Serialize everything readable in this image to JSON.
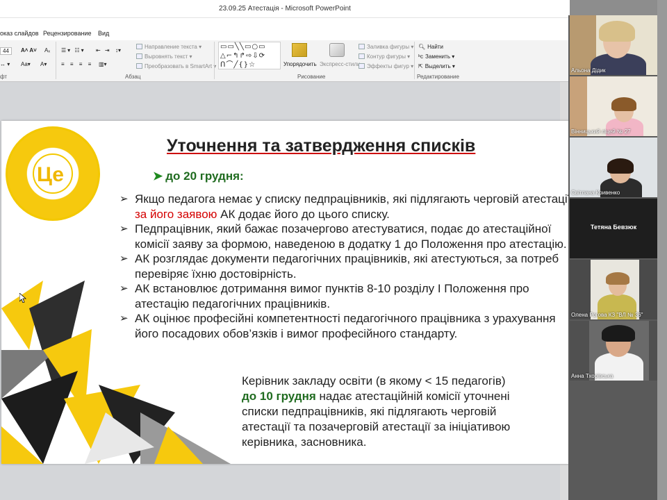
{
  "window": {
    "title": "23.09.25 Атестація  -  Microsoft PowerPoint"
  },
  "menu": {
    "items": [
      "оказ слайдов",
      "Рецензирование",
      "Вид"
    ]
  },
  "ribbon": {
    "font_size": "44",
    "text_direction": "Направление текста",
    "align_text": "Выровнять текст",
    "smartart": "Преобразовать в SmartArt",
    "arrange": "Упорядочить",
    "quick_styles": "Экспресс-стили",
    "shape_fill": "Заливка фигуры",
    "shape_outline": "Контур фигуры",
    "shape_effects": "Эффекты фигур",
    "find": "Найти",
    "replace": "Заменить",
    "select": "Выделить",
    "group_font": "фт",
    "group_paragraph": "Абзац",
    "group_drawing": "Рисование",
    "group_editing": "Редактирование"
  },
  "slide": {
    "logo_text": "Це",
    "title": "Уточнення та затвердження списків",
    "date_line": "до 20 грудня:",
    "bullets": [
      {
        "pre": "Якщо педагога немає у списку педпрацівників, які підлягають черговій атестації, ",
        "red": "за його заявою",
        "post": " АК додає його до цього списку."
      },
      {
        "pre": "Педпрацівник, який бажає позачергово атестуватися, подає до атестаційної комісії заяву за формою, наведеною в додатку 1 до Положення про атестацію.",
        "red": "",
        "post": ""
      },
      {
        "pre": "АК розглядає документи педагогічних працівників, які атестуються, за потреб перевіряє їхню достовірність.",
        "red": "",
        "post": ""
      },
      {
        "pre": "АК встановлює дотримання вимог пунктів 8-10 розділу І Положення про атестацію педагогічних працівників.",
        "red": "",
        "post": ""
      },
      {
        "pre": "АК оцінює професійні компетентності педагогічного працівника з урахування його посадових обов’язків і вимог професійного стандарту.",
        "red": "",
        "post": ""
      }
    ],
    "bottom": {
      "line1": "Керівник закладу освіти (в якому < 15 педагогів)",
      "deadline": "до 10 грудня",
      "rest": " надає атестаційній комісії уточнені списки педпрацівників, які підлягають черговій атестації та позачерговій атестації за ініціативою керівника, засновника."
    }
  },
  "participants": [
    {
      "name": "Альона Дідик",
      "video": true
    },
    {
      "name": "Вінницький ліцей № 27",
      "video": true
    },
    {
      "name": "Світлана Кривенко",
      "video": true
    },
    {
      "name": "Тетяна Бевзюк",
      "video": false
    },
    {
      "name": "Олена Рогова КЗ \"ВЛ № 36\"",
      "video": true
    },
    {
      "name": "Анна Тхорівська",
      "video": true
    }
  ],
  "colors": {
    "accent_yellow": "#f3c800",
    "deadline_green": "#1f6b1f",
    "emphasis_red": "#d40000"
  }
}
